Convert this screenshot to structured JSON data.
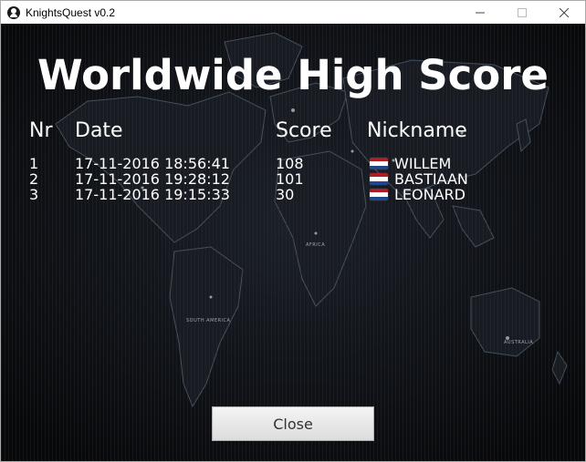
{
  "window": {
    "title": "KnightsQuest v0.2",
    "controls": {
      "minimize": "minimize-icon",
      "maximize": "maximize-icon",
      "close": "close-icon"
    }
  },
  "heading": "Worldwide High Score",
  "columns": {
    "nr": "Nr",
    "date": "Date",
    "score": "Score",
    "nickname": "Nickname"
  },
  "rows": [
    {
      "nr": "1",
      "date": "17-11-2016 18:56:41",
      "score": "108",
      "nickname": "WILLEM",
      "flag": "netherlands-flag-icon"
    },
    {
      "nr": "2",
      "date": "17-11-2016 19:28:12",
      "score": "101",
      "nickname": "BASTIAAN",
      "flag": "netherlands-flag-icon"
    },
    {
      "nr": "3",
      "date": "17-11-2016 19:15:33",
      "score": "30",
      "nickname": "LEONARD",
      "flag": "netherlands-flag-icon"
    }
  ],
  "map_labels": {
    "africa": "AFRICA",
    "south_america": "SOUTH AMERICA",
    "australia": "AUSTRALIA"
  },
  "close_button": "Close",
  "colors": {
    "background": "#0d0f12",
    "text": "#ffffff",
    "flag_red": "#ae1c28",
    "flag_white": "#ffffff",
    "flag_blue": "#21468b"
  }
}
